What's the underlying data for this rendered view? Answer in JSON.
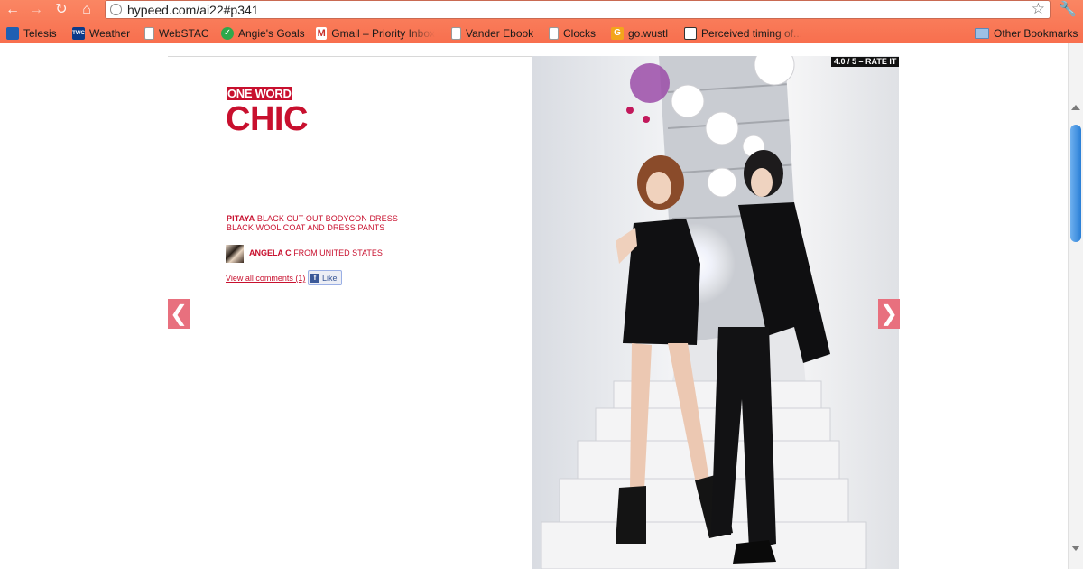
{
  "browser": {
    "url": "hypeed.com/ai22#p341",
    "bookmarks": [
      {
        "label": "Telesis",
        "icon": "telesis-icon"
      },
      {
        "label": "Weather",
        "icon": "twc-icon",
        "badge": "TWC"
      },
      {
        "label": "WebSTAC",
        "icon": "page-icon"
      },
      {
        "label": "Angie's Goals",
        "icon": "check-icon"
      },
      {
        "label": "Gmail – Priority Inbox",
        "icon": "gmail-icon"
      },
      {
        "label": "Vander Ebook",
        "icon": "page-icon"
      },
      {
        "label": "Clocks",
        "icon": "page-icon"
      },
      {
        "label": "go.wustl",
        "icon": "go-icon"
      },
      {
        "label": "Perceived timing of...",
        "icon": "perceived-icon"
      }
    ],
    "other_bookmarks": "Other Bookmarks"
  },
  "post": {
    "kicker": "ONE WORD",
    "title": "CHIC",
    "brand": "PITAYA",
    "item1": "BLACK CUT-OUT BODYCON DRESS",
    "item2": "BLACK WOOL COAT AND DRESS PANTS",
    "author_name": "ANGELA C",
    "author_location": "FROM UNITED STATES",
    "comments_link": "View all comments (1)",
    "like_label": "Like",
    "rating_text": "4.0 / 5 – RATE IT",
    "rating_value": 4.0,
    "rating_max": 5
  },
  "nav": {
    "prev_glyph": "❮",
    "next_glyph": "❯"
  },
  "colors": {
    "accent": "#c8102e",
    "chrome": "#f87a58",
    "arrow": "#e8707e"
  }
}
